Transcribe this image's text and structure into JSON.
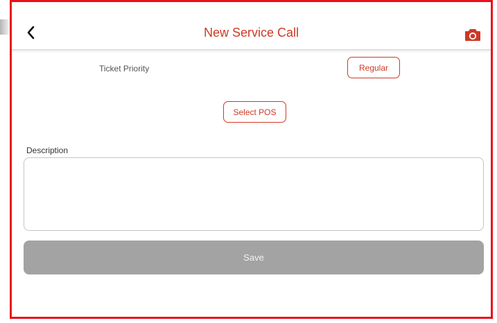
{
  "header": {
    "title": "New Service Call",
    "back_icon": "chevron-left-icon",
    "camera_icon": "camera-icon",
    "accent_color": "#cc3a25"
  },
  "form": {
    "priority_label": "Ticket Priority",
    "priority_value": "Regular",
    "select_pos_label": "Select POS",
    "description_label": "Description",
    "description_value": "",
    "save_label": "Save"
  }
}
